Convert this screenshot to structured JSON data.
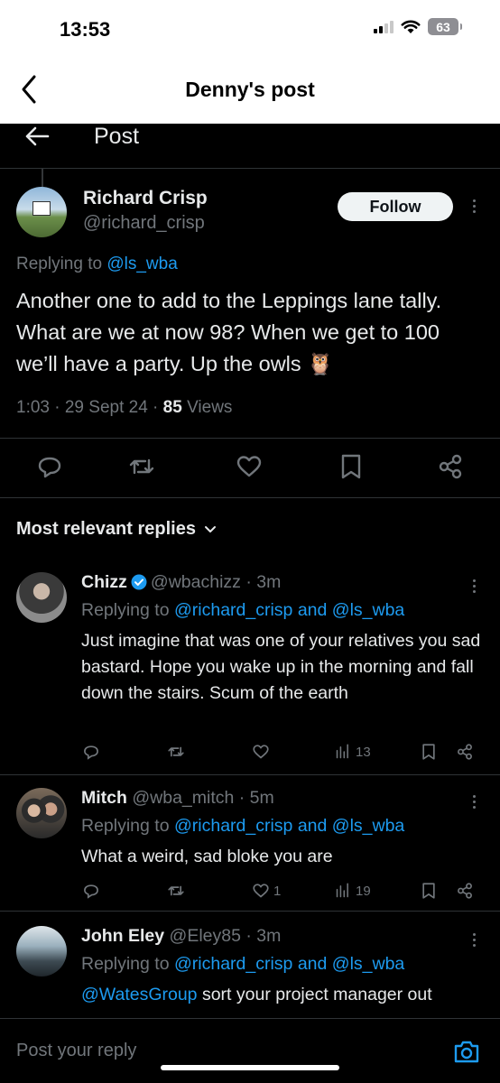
{
  "status_bar": {
    "time": "13:53",
    "battery": "63"
  },
  "nav": {
    "title": "Denny's post"
  },
  "x_header": {
    "title": "Post"
  },
  "main_post": {
    "name": "Richard Crisp",
    "handle": "@richard_crisp",
    "follow_label": "Follow",
    "replying_prefix": "Replying to ",
    "replying_to": "@ls_wba",
    "text": "Another one to add to the Leppings lane tally. What are we at now 98? When we get to 100 we’ll have a party. Up the owls 🦉",
    "time": "1:03 · 29 Sept 24 · ",
    "views_count": "85",
    "views_label": " Views"
  },
  "replies_header": {
    "label": "Most relevant replies"
  },
  "replies": [
    {
      "name": "Chizz",
      "handle": "@wbachizz · 3m",
      "replying_prefix": "Replying to ",
      "replying_to": "@richard_crisp and @ls_wba",
      "text": "Just imagine that was one of your relatives you sad bastard. Hope you wake up in the morning and fall down the stairs. Scum of the earth",
      "likes": "",
      "views": "13"
    },
    {
      "name": "Mitch",
      "handle": "@wba_mitch · 5m",
      "replying_prefix": "Replying to ",
      "replying_to": "@richard_crisp and @ls_wba",
      "text": "What a weird, sad bloke you are",
      "likes": "1",
      "views": "19"
    },
    {
      "name": "John Eley",
      "handle": "@Eley85 · 3m",
      "replying_prefix": "Replying to ",
      "replying_to": "@richard_crisp and @ls_wba",
      "text_link": "@WatesGroup",
      "text": " sort your project manager out"
    }
  ],
  "composer": {
    "placeholder": "Post your reply"
  },
  "colors": {
    "accent": "#1d9bf0",
    "background": "#000000",
    "muted": "#71767b",
    "text": "#e7e9ea"
  }
}
